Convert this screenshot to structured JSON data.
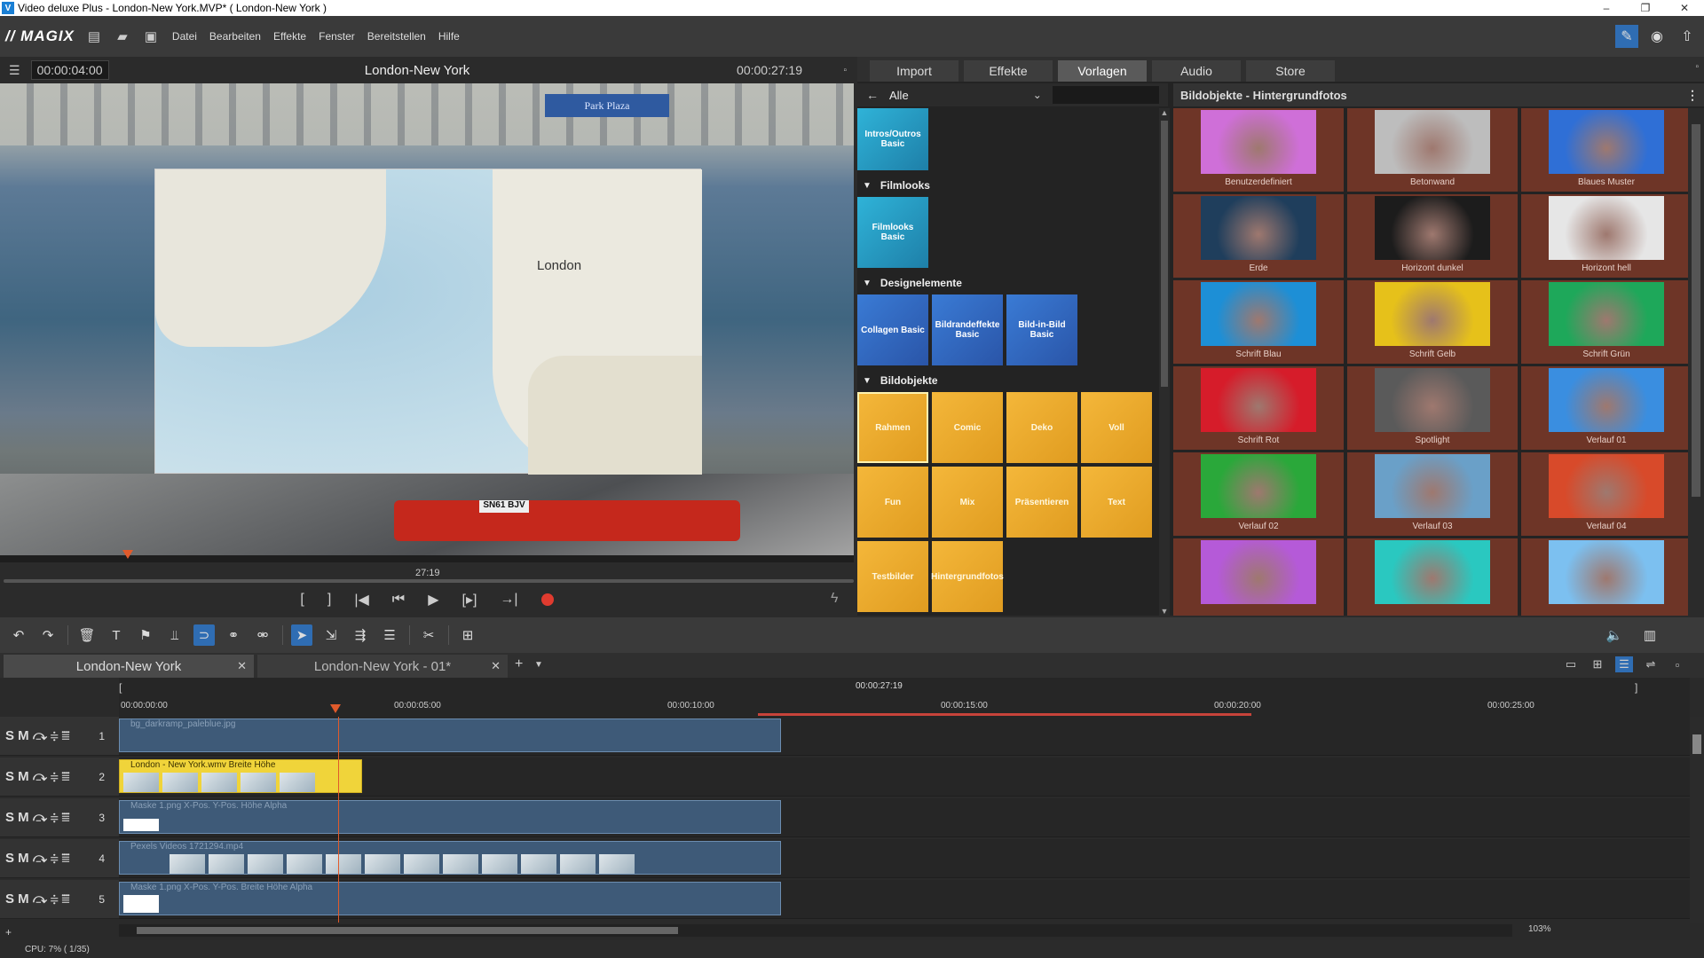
{
  "window": {
    "title": "Video deluxe Plus - London-New York.MVP* ( London-New York )",
    "controls": [
      "–",
      "❐",
      "✕"
    ]
  },
  "menubar": {
    "logo": "// MAGIX",
    "items": [
      "Datei",
      "Bearbeiten",
      "Effekte",
      "Fenster",
      "Bereitstellen",
      "Hilfe"
    ]
  },
  "preview": {
    "timecode": "00:00:04:00",
    "title": "London-New York",
    "duration": "00:00:27:19",
    "map_label": "London",
    "sign_text": "Park Plaza",
    "plate": "SN61 BJV",
    "scrub_time": "27:19"
  },
  "mediapool": {
    "tabs": [
      "Import",
      "Effekte",
      "Vorlagen",
      "Audio",
      "Store"
    ],
    "active_tab": "Vorlagen",
    "category": "Alle",
    "top_tile": "Intros/Outros Basic",
    "sections": [
      {
        "name": "Filmlooks",
        "tiles": [
          "Filmlooks Basic"
        ]
      },
      {
        "name": "Designelemente",
        "tiles": [
          "Collagen Basic",
          "Bildrandeffekte Basic",
          "Bild-in-Bild Basic"
        ]
      },
      {
        "name": "Bildobjekte",
        "tiles": [
          "Rahmen",
          "Comic",
          "Deko",
          "Voll",
          "Fun",
          "Mix",
          "Präsentieren",
          "Text",
          "Testbilder",
          "Hintergrundfotos"
        ]
      }
    ],
    "bg_header": "Bildobjekte - Hintergrundfotos",
    "backgrounds": [
      {
        "label": "Benutzerdefiniert",
        "color": "#cf6fd8"
      },
      {
        "label": "Betonwand",
        "color": "#bdbdbd"
      },
      {
        "label": "Blaues Muster",
        "color": "#2f6fd6"
      },
      {
        "label": "Erde",
        "color": "#1f3e5c"
      },
      {
        "label": "Horizont dunkel",
        "color": "#1c1c1c"
      },
      {
        "label": "Horizont hell",
        "color": "#e6e6e6"
      },
      {
        "label": "Schrift Blau",
        "color": "#1d8fd6"
      },
      {
        "label": "Schrift Gelb",
        "color": "#e6c11a"
      },
      {
        "label": "Schrift Grün",
        "color": "#1ea85a"
      },
      {
        "label": "Schrift Rot",
        "color": "#d61c2a"
      },
      {
        "label": "Spotlight",
        "color": "#5a5a5a"
      },
      {
        "label": "Verlauf 01",
        "color": "#3a8ee0"
      },
      {
        "label": "Verlauf 02",
        "color": "#2aa83a"
      },
      {
        "label": "Verlauf 03",
        "color": "#6aa0c8"
      },
      {
        "label": "Verlauf 04",
        "color": "#d84a2a"
      },
      {
        "label": "",
        "color": "#b55ad8"
      },
      {
        "label": "",
        "color": "#2ac8c0"
      },
      {
        "label": "",
        "color": "#7cc0f0"
      }
    ]
  },
  "project_tabs": [
    "London-New York",
    "London-New York - 01*"
  ],
  "timeline": {
    "duration": "00:00:27:19",
    "ticks": [
      "00:00:00:00",
      "00:00:05:00",
      "00:00:10:00",
      "00:00:15:00",
      "00:00:20:00",
      "00:00:25:00"
    ],
    "tracks": [
      {
        "num": "1",
        "clip": "bg_darkramp_paleblue.jpg"
      },
      {
        "num": "2",
        "clip": "London - New York.wmv  Breite  Höhe"
      },
      {
        "num": "3",
        "clip": "Maske 1.png  X-Pos.  Y-Pos.  Höhe Alpha"
      },
      {
        "num": "4",
        "clip": "Pexels Videos 1721294.mp4"
      },
      {
        "num": "5",
        "clip": "Maske 1.png  X-Pos.  Y-Pos.  Breite  Höhe Alpha"
      }
    ],
    "zoom": "103%"
  },
  "status": "CPU: 7% ( 1/35)"
}
